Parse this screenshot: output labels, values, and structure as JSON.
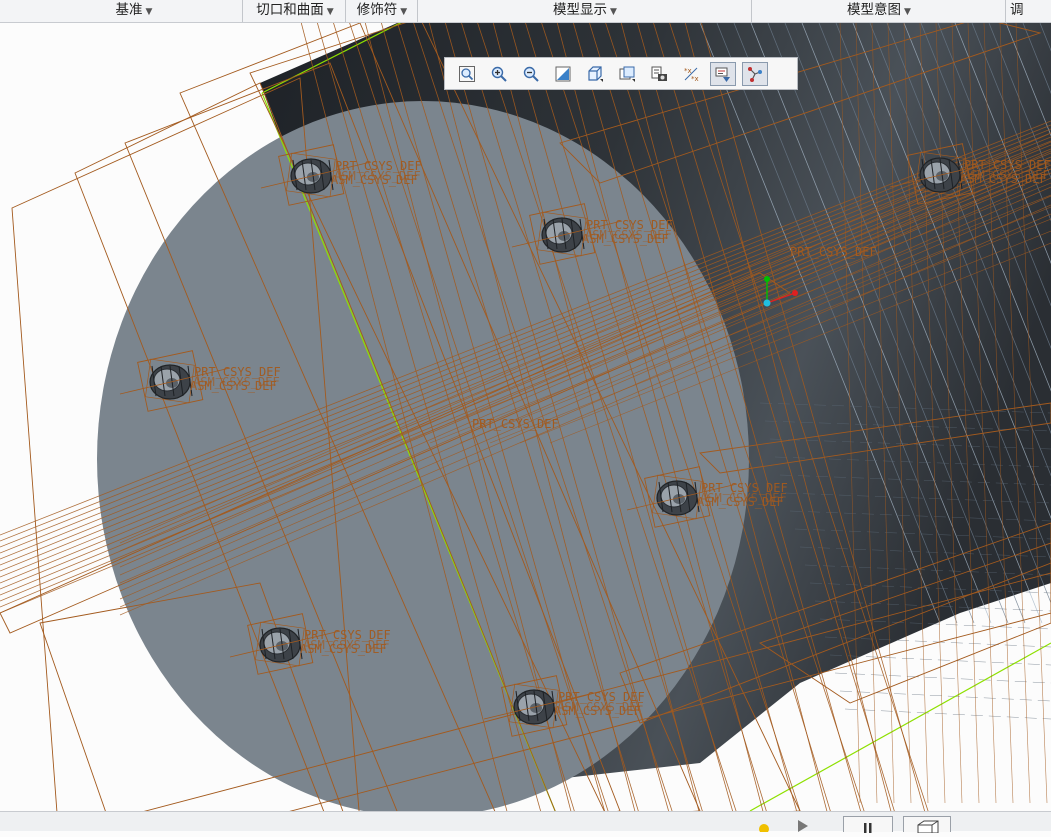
{
  "ribbon": {
    "groups": [
      {
        "label": "基准"
      },
      {
        "label": "切口和曲面"
      },
      {
        "label": "修饰符"
      },
      {
        "label": "模型显示"
      },
      {
        "label": "模型意图"
      },
      {
        "label": "调"
      }
    ]
  },
  "view_toolbar": {
    "buttons": [
      {
        "name": "zoom-refit-icon",
        "active": false
      },
      {
        "name": "zoom-in-icon",
        "active": false
      },
      {
        "name": "zoom-out-icon",
        "active": false
      },
      {
        "name": "repaint-icon",
        "active": false
      },
      {
        "name": "display-style-icon",
        "active": false
      },
      {
        "name": "saved-views-icon",
        "active": false
      },
      {
        "name": "view-manager-icon",
        "active": false
      },
      {
        "name": "datum-display-icon",
        "active": false
      },
      {
        "name": "annotation-display-icon",
        "active": true
      },
      {
        "name": "spin-center-icon",
        "active": true
      }
    ]
  },
  "model": {
    "csys_label": "PRT_CSYS_DEF",
    "overlap_label": "ASM_CSYS_DEF",
    "colors": {
      "disk": "#7b858e",
      "cylinder_dark": "#2b2f34",
      "wireframe": "#a35a1e",
      "datum_plane": "#8ee000",
      "edges": "#8aa0b4"
    }
  }
}
